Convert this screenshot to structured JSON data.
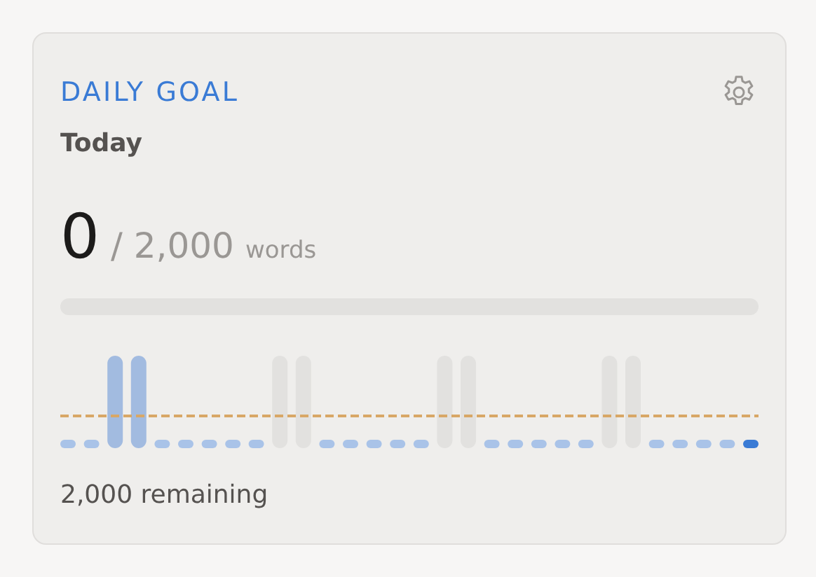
{
  "card": {
    "title": "DAILY GOAL",
    "period": "Today",
    "count": "0",
    "goal": "/ 2,000",
    "unit": "words",
    "progress": {
      "level": 0
    },
    "days": [
      {
        "kind": "low"
      },
      {
        "kind": "low"
      },
      {
        "kind": "high"
      },
      {
        "kind": "high"
      },
      {
        "kind": "low"
      },
      {
        "kind": "low"
      },
      {
        "kind": "low"
      },
      {
        "kind": "low"
      },
      {
        "kind": "low"
      },
      {
        "kind": "off"
      },
      {
        "kind": "off"
      },
      {
        "kind": "low"
      },
      {
        "kind": "low"
      },
      {
        "kind": "low"
      },
      {
        "kind": "low"
      },
      {
        "kind": "low"
      },
      {
        "kind": "off"
      },
      {
        "kind": "off"
      },
      {
        "kind": "low"
      },
      {
        "kind": "low"
      },
      {
        "kind": "low"
      },
      {
        "kind": "low"
      },
      {
        "kind": "low"
      },
      {
        "kind": "off"
      },
      {
        "kind": "off"
      },
      {
        "kind": "low"
      },
      {
        "kind": "low"
      },
      {
        "kind": "low"
      },
      {
        "kind": "low"
      },
      {
        "kind": "today"
      }
    ],
    "remaining": "2,000 remaining"
  }
}
